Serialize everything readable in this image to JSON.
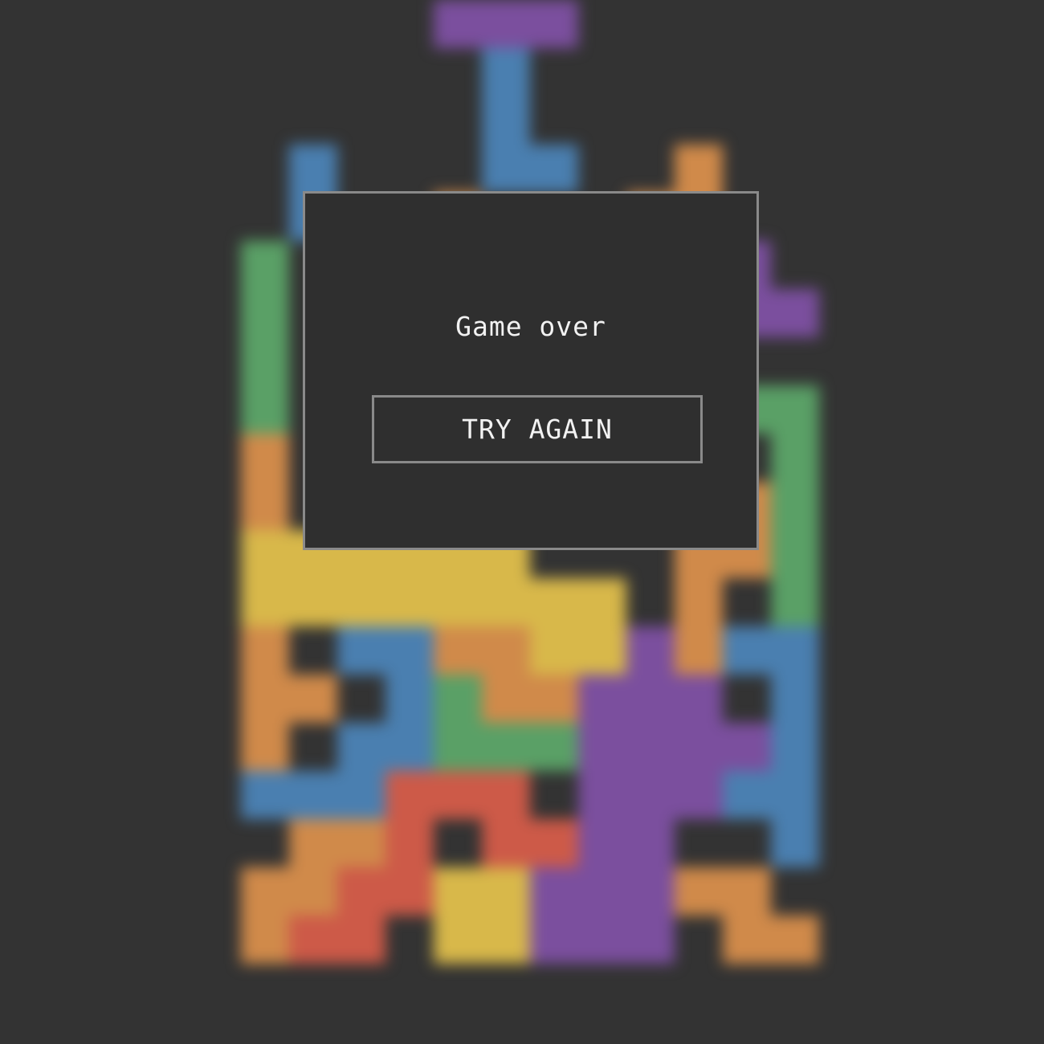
{
  "modal": {
    "title": "Game over",
    "button_label": "TRY AGAIN"
  },
  "colors": {
    "background": "#333333",
    "modal_bg": "#2f2f2f",
    "modal_border": "#8a8a8a",
    "text": "#f2f2f2",
    "blue": "#4a7fb0",
    "purple": "#7b4f9e",
    "orange": "#d08a4a",
    "green": "#5aa066",
    "yellow": "#d8b84a",
    "red": "#cd5a48"
  },
  "board": {
    "columns": 12,
    "rows": 20,
    "cells": [
      {
        "row": 0,
        "col": 4,
        "color": "purple"
      },
      {
        "row": 0,
        "col": 5,
        "color": "purple"
      },
      {
        "row": 0,
        "col": 6,
        "color": "purple"
      },
      {
        "row": 1,
        "col": 5,
        "color": "blue"
      },
      {
        "row": 2,
        "col": 5,
        "color": "blue"
      },
      {
        "row": 3,
        "col": 5,
        "color": "blue"
      },
      {
        "row": 3,
        "col": 6,
        "color": "blue"
      },
      {
        "row": 3,
        "col": 1,
        "color": "blue"
      },
      {
        "row": 4,
        "col": 1,
        "color": "blue"
      },
      {
        "row": 3,
        "col": 9,
        "color": "orange"
      },
      {
        "row": 4,
        "col": 9,
        "color": "orange"
      },
      {
        "row": 4,
        "col": 8,
        "color": "orange"
      },
      {
        "row": 4,
        "col": 4,
        "color": "orange"
      },
      {
        "row": 5,
        "col": 0,
        "color": "green"
      },
      {
        "row": 6,
        "col": 0,
        "color": "green"
      },
      {
        "row": 7,
        "col": 0,
        "color": "green"
      },
      {
        "row": 8,
        "col": 0,
        "color": "green"
      },
      {
        "row": 5,
        "col": 10,
        "color": "purple"
      },
      {
        "row": 6,
        "col": 10,
        "color": "purple"
      },
      {
        "row": 6,
        "col": 11,
        "color": "purple"
      },
      {
        "row": 8,
        "col": 11,
        "color": "green"
      },
      {
        "row": 9,
        "col": 11,
        "color": "green"
      },
      {
        "row": 10,
        "col": 11,
        "color": "green"
      },
      {
        "row": 11,
        "col": 11,
        "color": "green"
      },
      {
        "row": 12,
        "col": 11,
        "color": "green"
      },
      {
        "row": 8,
        "col": 10,
        "color": "green"
      },
      {
        "row": 9,
        "col": 0,
        "color": "orange"
      },
      {
        "row": 10,
        "col": 0,
        "color": "orange"
      },
      {
        "row": 10,
        "col": 9,
        "color": "orange"
      },
      {
        "row": 10,
        "col": 10,
        "color": "orange"
      },
      {
        "row": 11,
        "col": 9,
        "color": "orange"
      },
      {
        "row": 11,
        "col": 10,
        "color": "orange"
      },
      {
        "row": 11,
        "col": 0,
        "color": "yellow"
      },
      {
        "row": 11,
        "col": 1,
        "color": "yellow"
      },
      {
        "row": 11,
        "col": 2,
        "color": "yellow"
      },
      {
        "row": 11,
        "col": 3,
        "color": "yellow"
      },
      {
        "row": 11,
        "col": 4,
        "color": "yellow"
      },
      {
        "row": 11,
        "col": 5,
        "color": "yellow"
      },
      {
        "row": 12,
        "col": 0,
        "color": "yellow"
      },
      {
        "row": 12,
        "col": 1,
        "color": "yellow"
      },
      {
        "row": 12,
        "col": 2,
        "color": "yellow"
      },
      {
        "row": 12,
        "col": 3,
        "color": "yellow"
      },
      {
        "row": 12,
        "col": 4,
        "color": "yellow"
      },
      {
        "row": 12,
        "col": 5,
        "color": "yellow"
      },
      {
        "row": 12,
        "col": 6,
        "color": "yellow"
      },
      {
        "row": 12,
        "col": 7,
        "color": "yellow"
      },
      {
        "row": 13,
        "col": 6,
        "color": "yellow"
      },
      {
        "row": 13,
        "col": 7,
        "color": "yellow"
      },
      {
        "row": 12,
        "col": 9,
        "color": "orange"
      },
      {
        "row": 13,
        "col": 9,
        "color": "orange"
      },
      {
        "row": 13,
        "col": 10,
        "color": "blue"
      },
      {
        "row": 13,
        "col": 11,
        "color": "blue"
      },
      {
        "row": 14,
        "col": 11,
        "color": "blue"
      },
      {
        "row": 15,
        "col": 11,
        "color": "blue"
      },
      {
        "row": 16,
        "col": 11,
        "color": "blue"
      },
      {
        "row": 17,
        "col": 11,
        "color": "blue"
      },
      {
        "row": 16,
        "col": 10,
        "color": "blue"
      },
      {
        "row": 13,
        "col": 0,
        "color": "orange"
      },
      {
        "row": 14,
        "col": 0,
        "color": "orange"
      },
      {
        "row": 14,
        "col": 1,
        "color": "orange"
      },
      {
        "row": 15,
        "col": 0,
        "color": "orange"
      },
      {
        "row": 13,
        "col": 2,
        "color": "blue"
      },
      {
        "row": 13,
        "col": 3,
        "color": "blue"
      },
      {
        "row": 14,
        "col": 3,
        "color": "blue"
      },
      {
        "row": 15,
        "col": 2,
        "color": "blue"
      },
      {
        "row": 15,
        "col": 3,
        "color": "blue"
      },
      {
        "row": 16,
        "col": 0,
        "color": "blue"
      },
      {
        "row": 16,
        "col": 1,
        "color": "blue"
      },
      {
        "row": 16,
        "col": 2,
        "color": "blue"
      },
      {
        "row": 13,
        "col": 4,
        "color": "orange"
      },
      {
        "row": 13,
        "col": 5,
        "color": "orange"
      },
      {
        "row": 14,
        "col": 5,
        "color": "orange"
      },
      {
        "row": 14,
        "col": 6,
        "color": "orange"
      },
      {
        "row": 14,
        "col": 4,
        "color": "green"
      },
      {
        "row": 15,
        "col": 4,
        "color": "green"
      },
      {
        "row": 15,
        "col": 5,
        "color": "green"
      },
      {
        "row": 15,
        "col": 6,
        "color": "green"
      },
      {
        "row": 13,
        "col": 8,
        "color": "purple"
      },
      {
        "row": 14,
        "col": 7,
        "color": "purple"
      },
      {
        "row": 14,
        "col": 8,
        "color": "purple"
      },
      {
        "row": 14,
        "col": 9,
        "color": "purple"
      },
      {
        "row": 15,
        "col": 7,
        "color": "purple"
      },
      {
        "row": 15,
        "col": 8,
        "color": "purple"
      },
      {
        "row": 15,
        "col": 9,
        "color": "purple"
      },
      {
        "row": 15,
        "col": 10,
        "color": "purple"
      },
      {
        "row": 16,
        "col": 7,
        "color": "purple"
      },
      {
        "row": 16,
        "col": 8,
        "color": "purple"
      },
      {
        "row": 16,
        "col": 9,
        "color": "purple"
      },
      {
        "row": 17,
        "col": 7,
        "color": "purple"
      },
      {
        "row": 17,
        "col": 8,
        "color": "purple"
      },
      {
        "row": 18,
        "col": 6,
        "color": "purple"
      },
      {
        "row": 18,
        "col": 7,
        "color": "purple"
      },
      {
        "row": 18,
        "col": 8,
        "color": "purple"
      },
      {
        "row": 19,
        "col": 6,
        "color": "purple"
      },
      {
        "row": 19,
        "col": 7,
        "color": "purple"
      },
      {
        "row": 19,
        "col": 8,
        "color": "purple"
      },
      {
        "row": 16,
        "col": 3,
        "color": "red"
      },
      {
        "row": 16,
        "col": 4,
        "color": "red"
      },
      {
        "row": 16,
        "col": 5,
        "color": "red"
      },
      {
        "row": 17,
        "col": 3,
        "color": "red"
      },
      {
        "row": 17,
        "col": 5,
        "color": "red"
      },
      {
        "row": 17,
        "col": 6,
        "color": "red"
      },
      {
        "row": 18,
        "col": 2,
        "color": "red"
      },
      {
        "row": 18,
        "col": 3,
        "color": "red"
      },
      {
        "row": 19,
        "col": 1,
        "color": "red"
      },
      {
        "row": 19,
        "col": 2,
        "color": "red"
      },
      {
        "row": 17,
        "col": 1,
        "color": "orange"
      },
      {
        "row": 17,
        "col": 2,
        "color": "orange"
      },
      {
        "row": 18,
        "col": 0,
        "color": "orange"
      },
      {
        "row": 18,
        "col": 1,
        "color": "orange"
      },
      {
        "row": 19,
        "col": 0,
        "color": "orange"
      },
      {
        "row": 18,
        "col": 4,
        "color": "yellow"
      },
      {
        "row": 18,
        "col": 5,
        "color": "yellow"
      },
      {
        "row": 19,
        "col": 4,
        "color": "yellow"
      },
      {
        "row": 19,
        "col": 5,
        "color": "yellow"
      },
      {
        "row": 18,
        "col": 9,
        "color": "orange"
      },
      {
        "row": 18,
        "col": 10,
        "color": "orange"
      },
      {
        "row": 19,
        "col": 10,
        "color": "orange"
      },
      {
        "row": 19,
        "col": 11,
        "color": "orange"
      }
    ]
  }
}
